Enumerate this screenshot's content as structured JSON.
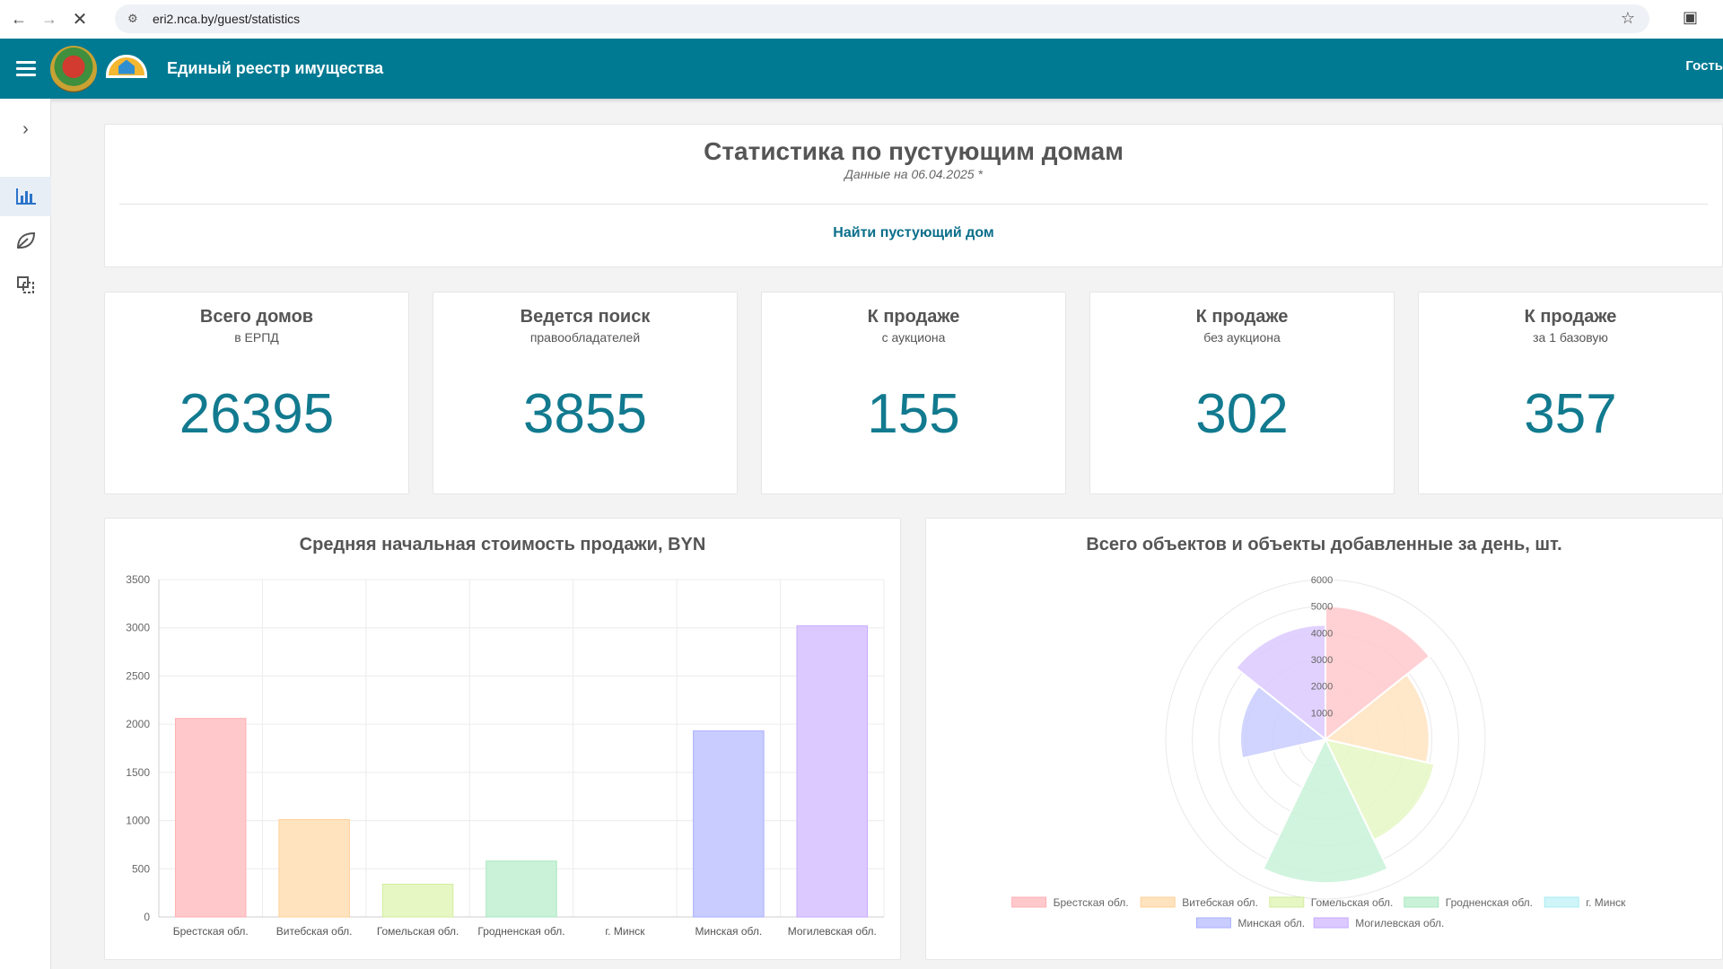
{
  "browser": {
    "url": "eri2.nca.by/guest/statistics"
  },
  "header": {
    "title": "Единый реестр имущества",
    "user": "Гость"
  },
  "page": {
    "title": "Статистика по пустующим домам",
    "subtitle": "Данные на 06.04.2025 *",
    "find_link": "Найти пустующий дом"
  },
  "stats": [
    {
      "title": "Всего домов",
      "sub": "в ЕРПД",
      "value": "26395"
    },
    {
      "title": "Ведется поиск",
      "sub": "правообладателей",
      "value": "3855"
    },
    {
      "title": "К продаже",
      "sub": "с аукциона",
      "value": "155"
    },
    {
      "title": "К продаже",
      "sub": "без аукциона",
      "value": "302"
    },
    {
      "title": "К продаже",
      "sub": "за 1 базовую",
      "value": "357"
    }
  ],
  "colors": {
    "fill": [
      "#ffc9cc",
      "#ffe3bf",
      "#e6f7c4",
      "#c9f2d8",
      "#cff5f8",
      "#c8ccff",
      "#dcc9ff"
    ],
    "stroke": [
      "#ffb0b6",
      "#ffd09a",
      "#d2ee9e",
      "#a9e8c0",
      "#a8ecf2",
      "#aab0ff",
      "#c7a9ff"
    ]
  },
  "chart_data": [
    {
      "type": "bar",
      "title": "Средняя начальная стоимость продажи, BYN",
      "categories": [
        "Брестская обл.",
        "Витебская обл.",
        "Гомельская обл.",
        "Гродненская обл.",
        "г. Минск",
        "Минская обл.",
        "Могилевская обл."
      ],
      "values": [
        2060,
        1010,
        340,
        580,
        0,
        1930,
        3020
      ],
      "ylim": [
        0,
        3500
      ],
      "yticks": [
        "0",
        "500",
        "1000",
        "1500",
        "2000",
        "2500",
        "3000",
        "3500"
      ],
      "grid": true
    },
    {
      "type": "polarArea",
      "title": "Всего объектов и объекты добавленные за день, шт.",
      "categories": [
        "Брестская обл.",
        "Витебская обл.",
        "Гомельская обл.",
        "Гродненская обл.",
        "г. Минск",
        "Минская обл.",
        "Могилевская обл."
      ],
      "values": [
        5000,
        3900,
        4200,
        5400,
        0,
        3200,
        4300
      ],
      "rlim": [
        0,
        6000
      ],
      "rticks": [
        "1000",
        "2000",
        "3000",
        "4000",
        "5000",
        "6000"
      ],
      "legend": "bottom"
    }
  ]
}
